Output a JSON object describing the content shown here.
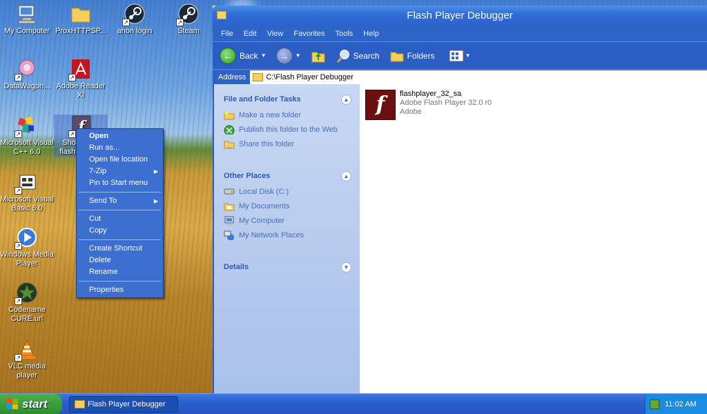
{
  "desktop": {
    "icons": [
      {
        "label": "My Computer",
        "icon": "computer-icon",
        "shortcut": false
      },
      {
        "label": "ProxHTTPSP...",
        "icon": "folder-icon",
        "shortcut": false
      },
      {
        "label": "anon login",
        "icon": "steam-icon",
        "shortcut": true
      },
      {
        "label": "Steam",
        "icon": "steam-icon",
        "shortcut": true
      },
      {
        "label": "DataWagon...",
        "icon": "datawagon-icon",
        "shortcut": true
      },
      {
        "label": "Adobe Reader XI",
        "icon": "adobe-reader-icon",
        "shortcut": true
      },
      {
        "label": "Microsoft Visual C++ 6.0",
        "icon": "visual-cpp-icon",
        "shortcut": true
      },
      {
        "label": "Shortcut to flashplayer...",
        "icon": "flash-icon",
        "shortcut": true
      },
      {
        "label": "Microsoft Visual Basic 6.0",
        "icon": "visual-basic-icon",
        "shortcut": true
      },
      {
        "label": "Windows Media Player",
        "icon": "media-player-icon",
        "shortcut": true
      },
      {
        "label": "Codename CURE.url",
        "icon": "codename-cure-icon",
        "shortcut": true
      },
      {
        "label": "VLC media player",
        "icon": "vlc-icon",
        "shortcut": true
      }
    ]
  },
  "context_menu": {
    "items": [
      {
        "label": "Open",
        "bold": true
      },
      {
        "label": "Run as..."
      },
      {
        "label": "Open file location"
      },
      {
        "label": "7-Zip",
        "submenu": true
      },
      {
        "label": "Pin to Start menu"
      },
      {
        "label": "Send To",
        "submenu": true
      },
      {
        "label": "Cut"
      },
      {
        "label": "Copy"
      },
      {
        "label": "Create Shortcut"
      },
      {
        "label": "Delete"
      },
      {
        "label": "Rename"
      },
      {
        "label": "Properties"
      }
    ]
  },
  "window": {
    "title": "Flash Player Debugger",
    "menu": [
      "File",
      "Edit",
      "View",
      "Favorites",
      "Tools",
      "Help"
    ],
    "toolbar": {
      "back": "Back",
      "search": "Search",
      "folders": "Folders"
    },
    "address_label": "Address",
    "address": "C:\\Flash Player Debugger",
    "tasks_panel": {
      "title": "File and Folder Tasks",
      "items": [
        "Make a new folder",
        "Publish this folder to the Web",
        "Share this folder"
      ]
    },
    "places_panel": {
      "title": "Other Places",
      "items": [
        "Local Disk (C:)",
        "My Documents",
        "My Computer",
        "My Network Places"
      ]
    },
    "details_panel": {
      "title": "Details"
    },
    "file": {
      "name": "flashplayer_32_sa",
      "description": "Adobe Flash Player 32.0 r0",
      "company": "Adobe"
    }
  },
  "taskbar": {
    "start_label": "start",
    "task_label": "Flash Player Debugger",
    "clock": "11:02 AM"
  },
  "colors": {
    "accent": "#2a5ec4",
    "taskbar": "#2555c2",
    "start": "#2d8c2d"
  }
}
